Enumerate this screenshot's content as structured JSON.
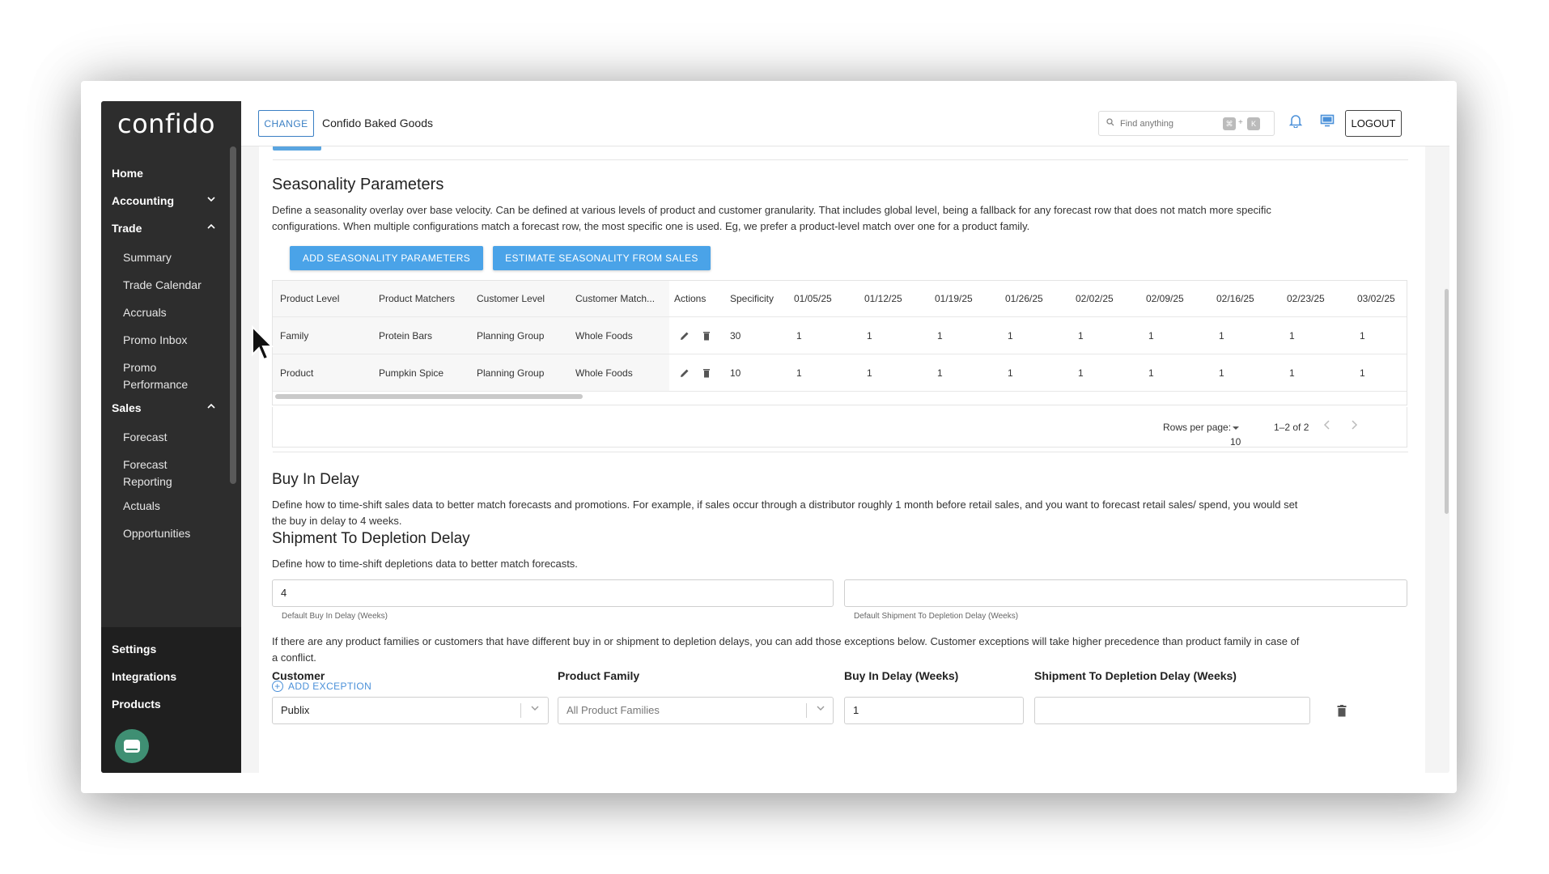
{
  "sidebar": {
    "logo": "confido",
    "home": "Home",
    "accounting": "Accounting",
    "trade": "Trade",
    "trade_items": [
      "Summary",
      "Trade Calendar",
      "Accruals",
      "Promo Inbox",
      "Promo",
      "Performance"
    ],
    "sales": "Sales",
    "sales_items": [
      "Forecast",
      "Forecast",
      "Reporting",
      "Actuals",
      "Opportunities"
    ],
    "settings": "Settings",
    "integrations": "Integrations",
    "products": "Products"
  },
  "header": {
    "change_label": "CHANGE",
    "company": "Confido Baked Goods",
    "search_placeholder": "Find anything",
    "kbd_1": "⌘",
    "kbd_plus": "+",
    "kbd_2": "K",
    "logout_label": "LOGOUT"
  },
  "seasonality": {
    "title": "Seasonality Parameters",
    "description_1": "Define a seasonality overlay over base velocity. Can be defined at various levels of product and customer granularity. That includes global level, being a fallback for any forecast row that does not match more specific",
    "description_2": "configurations. When multiple configurations match a forecast row, the most specific one is used. Eg, we prefer a product-level match over one for a product family.",
    "add_button": "ADD SEASONALITY PARAMETERS",
    "estimate_button": "ESTIMATE SEASONALITY FROM SALES",
    "columns": [
      "Product Level",
      "Product Matchers",
      "Customer Level",
      "Customer Match...",
      "Actions",
      "Specificity",
      "01/05/25",
      "01/12/25",
      "01/19/25",
      "01/26/25",
      "02/02/25",
      "02/09/25",
      "02/16/25",
      "02/23/25",
      "03/02/25"
    ],
    "rows": [
      [
        "Family",
        "Protein Bars",
        "Planning Group",
        "Whole Foods",
        "",
        "30",
        "1",
        "1",
        "1",
        "1",
        "1",
        "1",
        "1",
        "1",
        "1"
      ],
      [
        "Product",
        "Pumpkin Spice",
        "Planning Group",
        "Whole Foods",
        "",
        "10",
        "1",
        "1",
        "1",
        "1",
        "1",
        "1",
        "1",
        "1",
        "1"
      ]
    ],
    "pager": {
      "rows_per_page_label": "Rows per page:",
      "rows_per_page_value": "10",
      "range": "1–2 of 2"
    }
  },
  "buy_in": {
    "title": "Buy In Delay",
    "description_1": "Define how to time-shift sales data to better match forecasts and promotions. For example, if sales occur through a distributor roughly 1 month before retail sales, and you want to forecast retail sales/ spend, you would set",
    "description_2": "the buy in delay to 4 weeks."
  },
  "shipment": {
    "title": "Shipment To Depletion Delay",
    "description": "Define how to time-shift depletions data to better match forecasts.",
    "default_buy_in_value": "4",
    "default_buy_in_helper": "Default Buy In Delay (Weeks)",
    "default_shipment_value": "",
    "default_shipment_helper": "Default Shipment To Depletion Delay (Weeks)"
  },
  "exceptions": {
    "note_1": "If there are any product families or customers that have different buy in or shipment to depletion delays, you can add those exceptions below. Customer exceptions will take higher precedence than product family in case of",
    "note_2": "a conflict.",
    "col_customer": "Customer",
    "col_product_family": "Product Family",
    "col_buy_in": "Buy In Delay (Weeks)",
    "col_shipment": "Shipment To Depletion Delay (Weeks)",
    "row": {
      "customer": "Publix",
      "product_family": "All Product Families",
      "buy_in": "1",
      "shipment": ""
    },
    "add_label": "ADD EXCEPTION"
  },
  "colors": {
    "sidebar_bg": "#2d2d2d",
    "primary_blue": "#4aa3e8",
    "link_blue": "#4a90d9",
    "chat_green": "#3f8f73"
  }
}
